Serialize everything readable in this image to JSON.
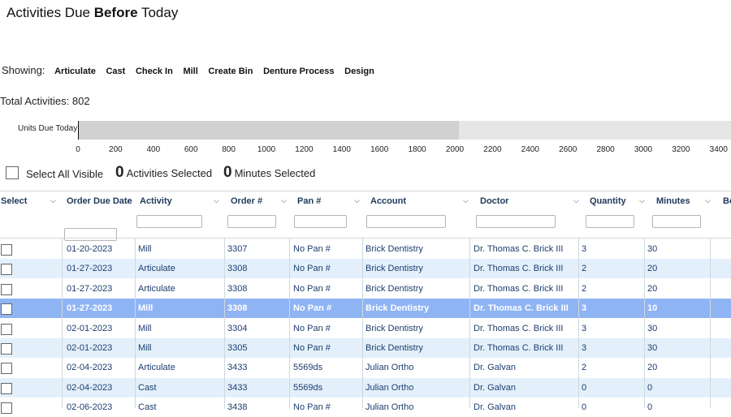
{
  "page": {
    "title_prefix": "Activities Due ",
    "title_bold": "Before",
    "title_suffix": " Today",
    "showing_label": "Showing:",
    "filters": [
      "Articulate",
      "Cast",
      "Check In",
      "Mill",
      "Create Bin",
      "Denture Process",
      "Design"
    ],
    "total_activities": "Total Activities: 802"
  },
  "units_chart": {
    "label": "Units Due Today",
    "ticks": [
      "0",
      "200",
      "400",
      "600",
      "800",
      "1000",
      "1200",
      "1400",
      "1600",
      "1800",
      "2000",
      "2200",
      "2400",
      "2600",
      "2800",
      "3000",
      "3200",
      "3400"
    ],
    "value": 2020,
    "max": 3460
  },
  "selection": {
    "select_all_label": "Select All Visible",
    "activities_selected_count": "0",
    "activities_selected_label": "Activities Selected",
    "minutes_selected_count": "0",
    "minutes_selected_label": "Minutes Selected"
  },
  "columns": [
    "Select",
    "Order Due Date",
    "Activity",
    "Order #",
    "Pan #",
    "Account",
    "Doctor",
    "Quantity",
    "Minutes",
    "Bo"
  ],
  "rows": [
    {
      "date": "01-20-2023",
      "activity": "Mill",
      "order": "3307",
      "pan": "No Pan #",
      "account": "Brick Dentistry",
      "doctor": "Dr. Thomas C. Brick III",
      "qty": "3",
      "minutes": "30",
      "selected": false
    },
    {
      "date": "01-27-2023",
      "activity": "Articulate",
      "order": "3308",
      "pan": "No Pan #",
      "account": "Brick Dentistry",
      "doctor": "Dr. Thomas C. Brick III",
      "qty": "2",
      "minutes": "20",
      "selected": false
    },
    {
      "date": "01-27-2023",
      "activity": "Articulate",
      "order": "3308",
      "pan": "No Pan #",
      "account": "Brick Dentistry",
      "doctor": "Dr. Thomas C. Brick III",
      "qty": "2",
      "minutes": "20",
      "selected": false
    },
    {
      "date": "01-27-2023",
      "activity": "Mill",
      "order": "3308",
      "pan": "No Pan #",
      "account": "Brick Dentistry",
      "doctor": "Dr. Thomas C. Brick III",
      "qty": "3",
      "minutes": "10",
      "selected": true
    },
    {
      "date": "02-01-2023",
      "activity": "Mill",
      "order": "3304",
      "pan": "No Pan #",
      "account": "Brick Dentistry",
      "doctor": "Dr. Thomas C. Brick III",
      "qty": "3",
      "minutes": "30",
      "selected": false
    },
    {
      "date": "02-01-2023",
      "activity": "Mill",
      "order": "3305",
      "pan": "No Pan #",
      "account": "Brick Dentistry",
      "doctor": "Dr. Thomas C. Brick III",
      "qty": "3",
      "minutes": "30",
      "selected": false
    },
    {
      "date": "02-04-2023",
      "activity": "Articulate",
      "order": "3433",
      "pan": "5569ds",
      "account": "Julian Ortho",
      "doctor": "Dr. Galvan",
      "qty": "2",
      "minutes": "20",
      "selected": false
    },
    {
      "date": "02-04-2023",
      "activity": "Cast",
      "order": "3433",
      "pan": "5569ds",
      "account": "Julian Ortho",
      "doctor": "Dr. Galvan",
      "qty": "0",
      "minutes": "0",
      "selected": false
    },
    {
      "date": "02-06-2023",
      "activity": "Cast",
      "order": "3438",
      "pan": "No Pan #",
      "account": "Julian Ortho",
      "doctor": "Dr. Galvan",
      "qty": "0",
      "minutes": "0",
      "selected": false
    }
  ]
}
